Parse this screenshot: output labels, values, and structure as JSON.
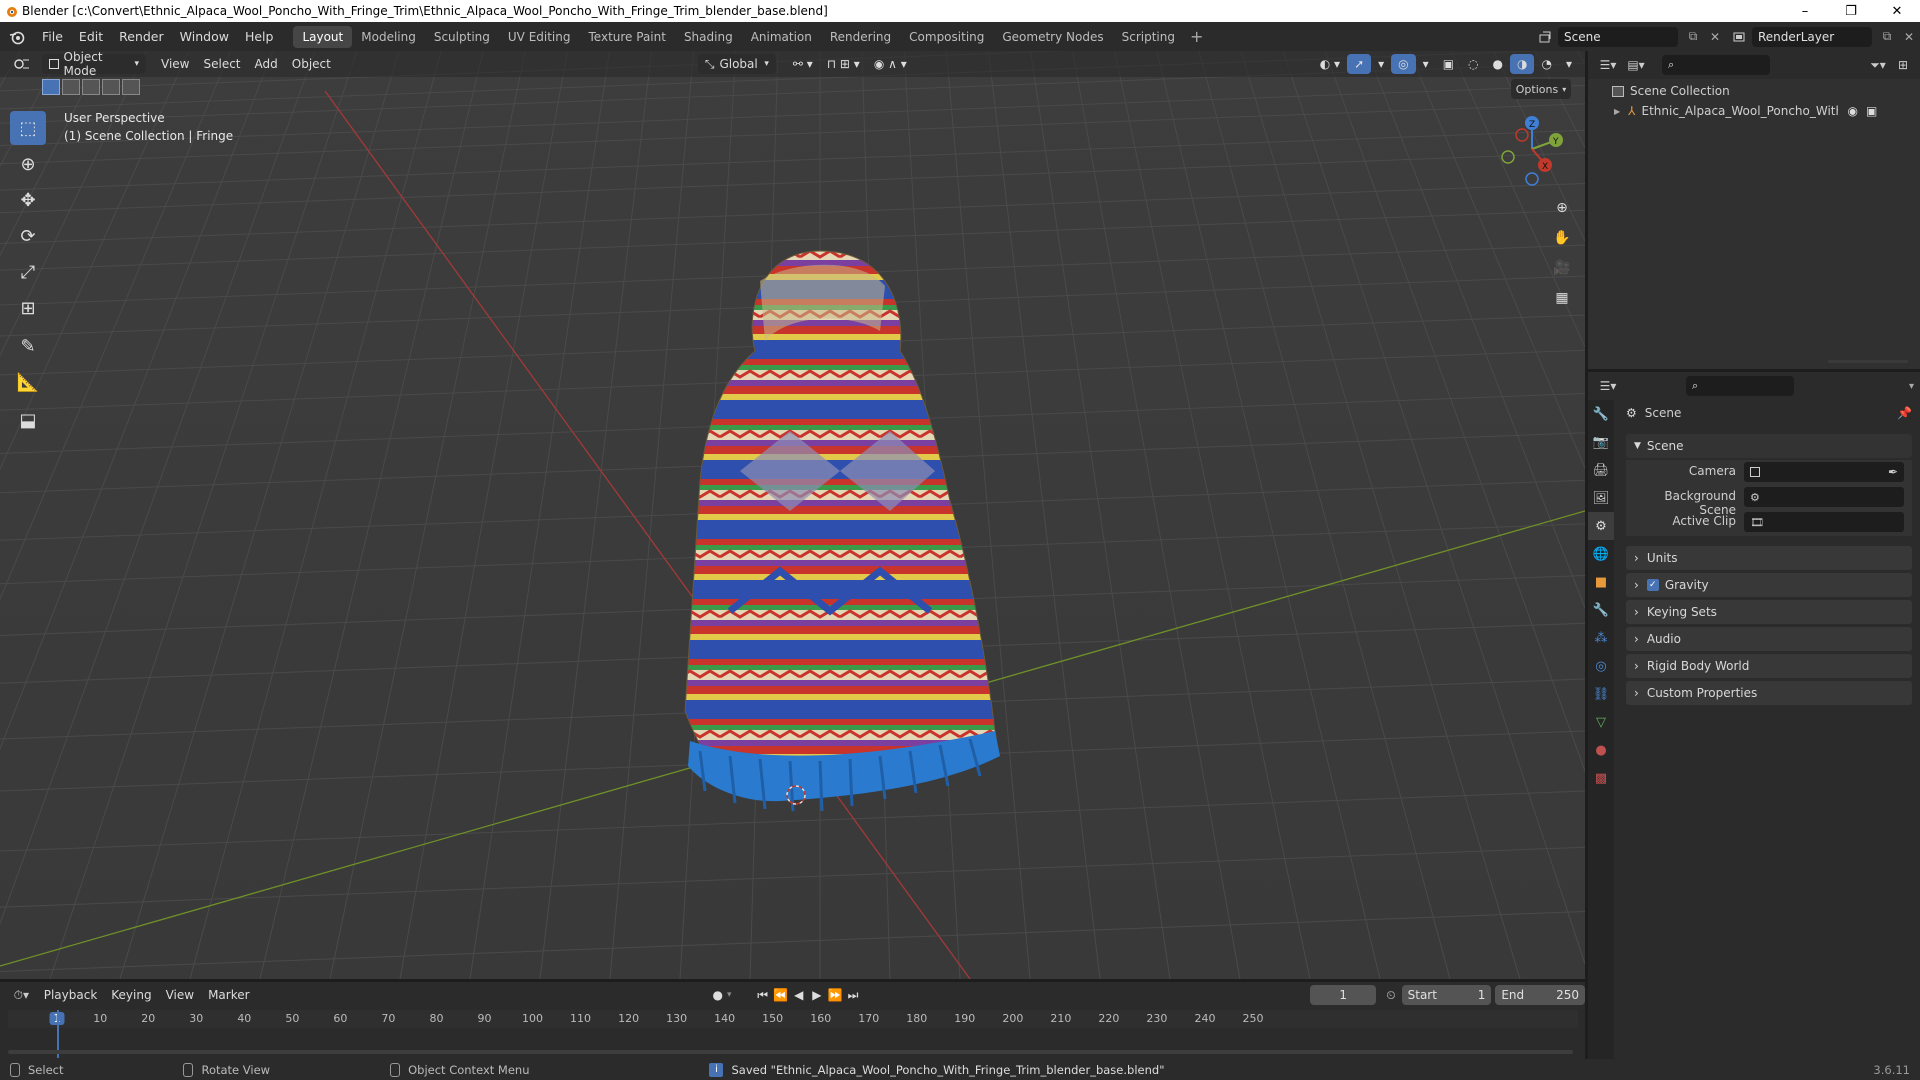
{
  "window": {
    "title": "Blender [c:\\Convert\\Ethnic_Alpaca_Wool_Poncho_With_Fringe_Trim\\Ethnic_Alpaca_Wool_Poncho_With_Fringe_Trim_blender_base.blend]",
    "minimize": "–",
    "maximize": "❐",
    "close": "✕"
  },
  "menu": [
    "File",
    "Edit",
    "Render",
    "Window",
    "Help"
  ],
  "workspaces": [
    "Layout",
    "Modeling",
    "Sculpting",
    "UV Editing",
    "Texture Paint",
    "Shading",
    "Animation",
    "Rendering",
    "Compositing",
    "Geometry Nodes",
    "Scripting"
  ],
  "active_workspace": "Layout",
  "add_workspace": "+",
  "scene_field": "Scene",
  "renderlayer_field": "RenderLayer",
  "viewport": {
    "mode": "Object Mode",
    "menus": [
      "View",
      "Select",
      "Add",
      "Object"
    ],
    "transform_orientation": "Global",
    "options_label": "Options",
    "overlay_line1": "User Perspective",
    "overlay_line2": "(1) Scene Collection | Fringe",
    "gizmo_axes": {
      "x": "X",
      "y": "Y",
      "z": "Z"
    }
  },
  "colors": {
    "accent": "#4772b3",
    "x_axis": "#c0392b",
    "y_axis": "#7fa33a",
    "z_axis": "#3f7fd6",
    "poncho_blue": "#2a7bd0",
    "poncho_red": "#c8332b",
    "poncho_yellow": "#e2c94a"
  },
  "outliner": {
    "root": "Scene Collection",
    "items": [
      {
        "label": "Ethnic_Alpaca_Wool_Poncho_With_Fring"
      }
    ]
  },
  "properties": {
    "header": "Scene",
    "panel_title": "Scene",
    "fields": [
      {
        "label": "Camera",
        "value": ""
      },
      {
        "label": "Background Scene",
        "value": ""
      },
      {
        "label": "Active Clip",
        "value": ""
      }
    ],
    "sections": [
      "Units",
      "Gravity",
      "Keying Sets",
      "Audio",
      "Rigid Body World",
      "Custom Properties"
    ],
    "gravity_checked": true
  },
  "timeline": {
    "menus": [
      "Playback",
      "Keying",
      "View",
      "Marker"
    ],
    "current_frame": "1",
    "start_label": "Start",
    "start": "1",
    "end_label": "End",
    "end": "250",
    "ruler": [
      "1",
      "10",
      "20",
      "30",
      "40",
      "50",
      "60",
      "70",
      "80",
      "90",
      "100",
      "110",
      "120",
      "130",
      "140",
      "150",
      "160",
      "170",
      "180",
      "190",
      "200",
      "210",
      "220",
      "230",
      "240",
      "250"
    ]
  },
  "status": {
    "select": "Select",
    "rotate": "Rotate View",
    "context": "Object Context Menu",
    "message": "Saved \"Ethnic_Alpaca_Wool_Poncho_With_Fringe_Trim_blender_base.blend\"",
    "version": "3.6.11"
  }
}
